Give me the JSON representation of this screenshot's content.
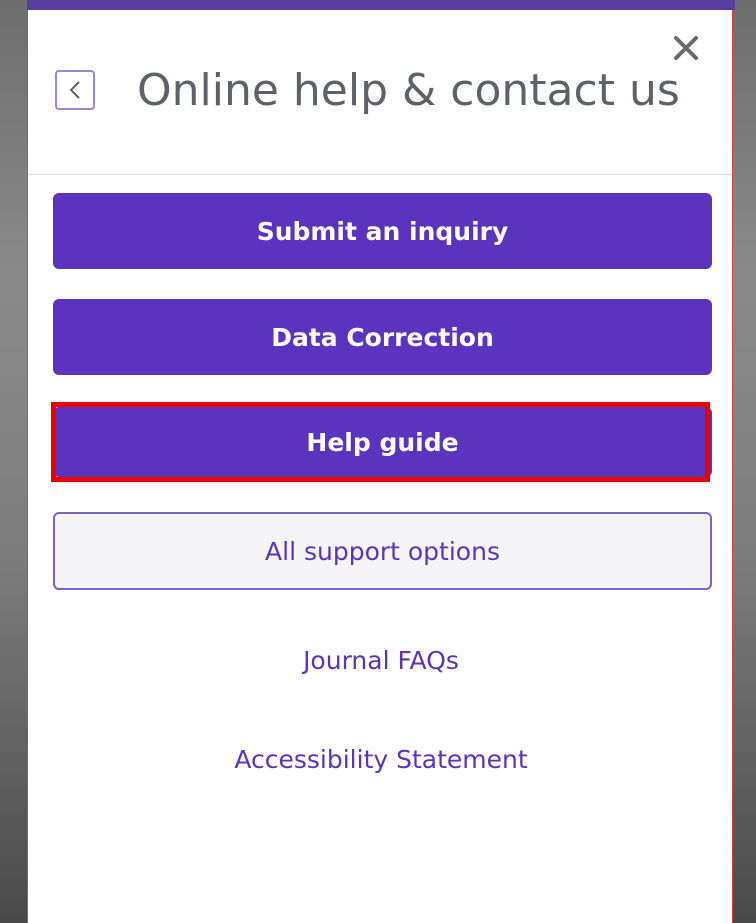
{
  "dialog": {
    "title": "Online help & contact us",
    "back_icon": "chevron-left-icon",
    "close_icon": "close-icon",
    "close_glyph": "✕"
  },
  "buttons": {
    "submit_inquiry": "Submit an inquiry",
    "data_correction": "Data Correction",
    "help_guide": "Help guide",
    "all_support": "All support options"
  },
  "links": {
    "journal_faqs": "Journal FAQs",
    "accessibility": "Accessibility Statement"
  },
  "colors": {
    "primary": "#5c33be",
    "title_text": "#5f6168",
    "highlight": "#ee0000",
    "outline_bg": "#f5f5f8"
  }
}
